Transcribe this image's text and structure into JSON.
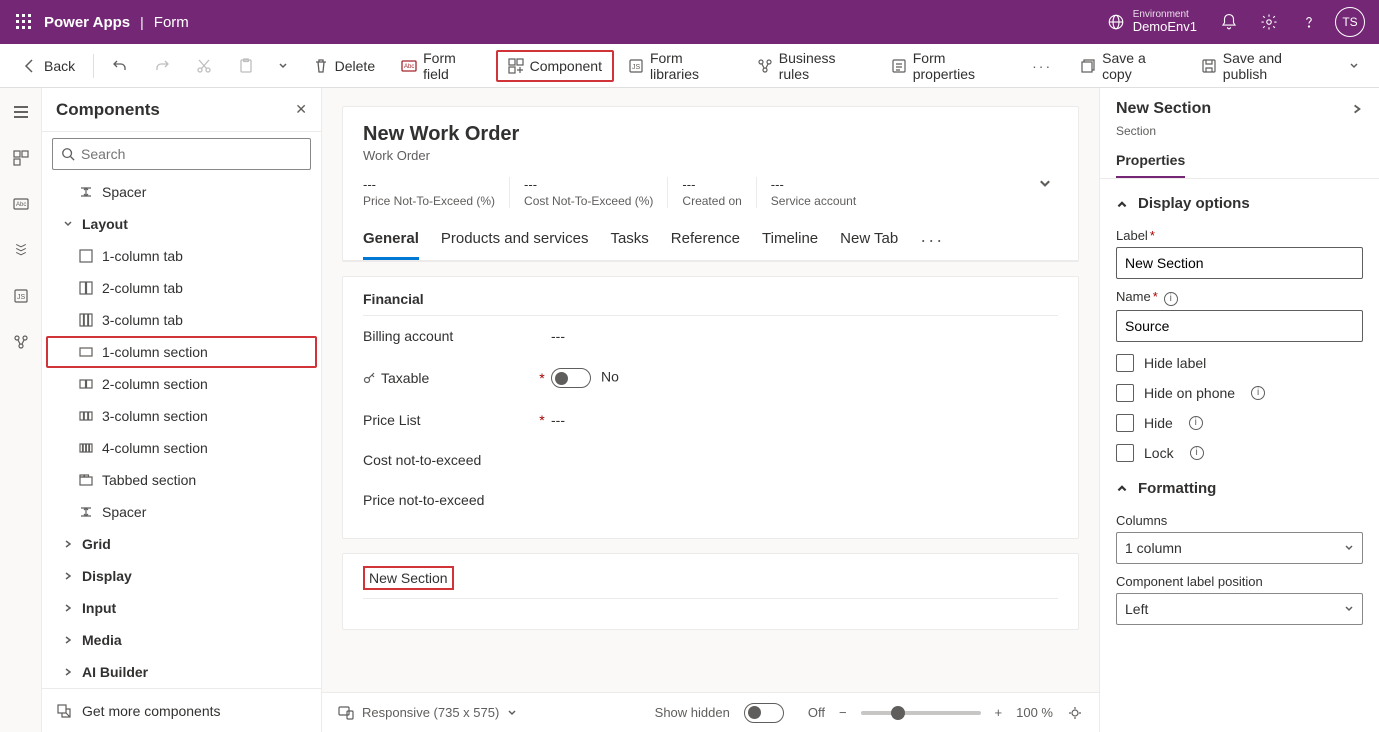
{
  "topbar": {
    "brand": "Power Apps",
    "page": "Form",
    "env_label": "Environment",
    "env_value": "DemoEnv1",
    "avatar_initials": "TS"
  },
  "ribbon": {
    "back": "Back",
    "delete": "Delete",
    "form_field": "Form field",
    "component": "Component",
    "form_libraries": "Form libraries",
    "business_rules": "Business rules",
    "form_properties": "Form properties",
    "save_copy": "Save a copy",
    "save_publish": "Save and publish"
  },
  "panel": {
    "title": "Components",
    "search_placeholder": "Search",
    "items_top": [
      {
        "label": "Spacer",
        "icon": "spacer"
      }
    ],
    "layout_group": "Layout",
    "layout_items": [
      {
        "label": "1-column tab",
        "icon": "col1"
      },
      {
        "label": "2-column tab",
        "icon": "col2"
      },
      {
        "label": "3-column tab",
        "icon": "col3"
      },
      {
        "label": "1-column section",
        "icon": "sec1",
        "highlight": true
      },
      {
        "label": "2-column section",
        "icon": "sec2"
      },
      {
        "label": "3-column section",
        "icon": "sec3"
      },
      {
        "label": "4-column section",
        "icon": "sec4"
      },
      {
        "label": "Tabbed section",
        "icon": "tabbed"
      },
      {
        "label": "Spacer",
        "icon": "spacer"
      }
    ],
    "groups": [
      "Grid",
      "Display",
      "Input",
      "Media",
      "AI Builder"
    ],
    "footer": "Get more components"
  },
  "form": {
    "title": "New Work Order",
    "subtitle": "Work Order",
    "summary": [
      {
        "value": "---",
        "label": "Price Not-To-Exceed (%)"
      },
      {
        "value": "---",
        "label": "Cost Not-To-Exceed (%)"
      },
      {
        "value": "---",
        "label": "Created on"
      },
      {
        "value": "---",
        "label": "Service account"
      }
    ],
    "tabs": [
      "General",
      "Products and services",
      "Tasks",
      "Reference",
      "Timeline",
      "New Tab"
    ],
    "section_title": "Financial",
    "fields": [
      {
        "label": "Billing account",
        "required": false,
        "value": "---",
        "type": "text"
      },
      {
        "label": "Taxable",
        "required": true,
        "value": "No",
        "type": "toggle",
        "icon": true
      },
      {
        "label": "Price List",
        "required": true,
        "value": "---",
        "type": "text"
      },
      {
        "label": "Cost not-to-exceed",
        "required": false,
        "value": "",
        "type": "text"
      },
      {
        "label": "Price not-to-exceed",
        "required": false,
        "value": "",
        "type": "text"
      }
    ],
    "new_section": "New Section"
  },
  "footer": {
    "responsive": "Responsive (735 x 575)",
    "show_hidden": "Show hidden",
    "show_hidden_state": "Off",
    "zoom": "100 %"
  },
  "props": {
    "title": "New Section",
    "subtitle": "Section",
    "tab": "Properties",
    "group_display": "Display options",
    "label_label": "Label",
    "label_value": "New Section",
    "name_label": "Name",
    "name_value": "Source",
    "checks": [
      "Hide label",
      "Hide on phone",
      "Hide",
      "Lock"
    ],
    "group_formatting": "Formatting",
    "columns_label": "Columns",
    "columns_value": "1 column",
    "clp_label": "Component label position",
    "clp_value": "Left"
  }
}
